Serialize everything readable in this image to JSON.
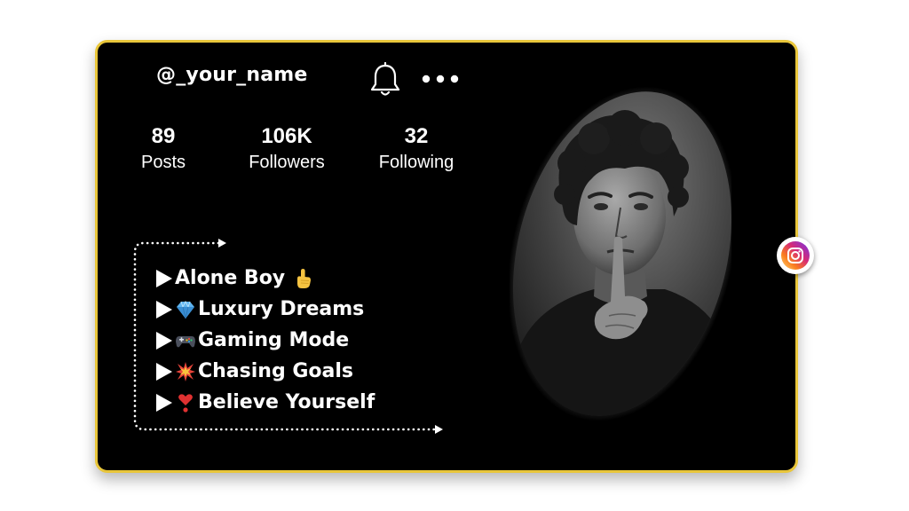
{
  "profile": {
    "username": "@_your_name",
    "stats": [
      {
        "value": "89",
        "label": "Posts"
      },
      {
        "value": "106K",
        "label": "Followers"
      },
      {
        "value": "32",
        "label": "Following"
      }
    ]
  },
  "actions": {
    "notification_icon": "bell-icon",
    "more_icon": "more-horizontal-icon"
  },
  "bio": {
    "items": [
      {
        "text": "Alone Boy",
        "emoji": "pointing-up-hand",
        "emoji_position": "after"
      },
      {
        "text": "Luxury Dreams",
        "emoji": "gem",
        "emoji_position": "before"
      },
      {
        "text": "Gaming Mode",
        "emoji": "game-controller",
        "emoji_position": "before"
      },
      {
        "text": "Chasing Goals",
        "emoji": "collision",
        "emoji_position": "before"
      },
      {
        "text": "Believe Yourself",
        "emoji": "heart-exclamation",
        "emoji_position": "before"
      }
    ]
  },
  "badge": {
    "icon": "instagram-icon"
  },
  "colors": {
    "card_background": "#000000",
    "card_border": "#e9c63a",
    "text": "#ffffff",
    "instagram_gradient": [
      "#feda75",
      "#fa7e1e",
      "#d62976",
      "#962fbf",
      "#4f5bd5"
    ]
  }
}
